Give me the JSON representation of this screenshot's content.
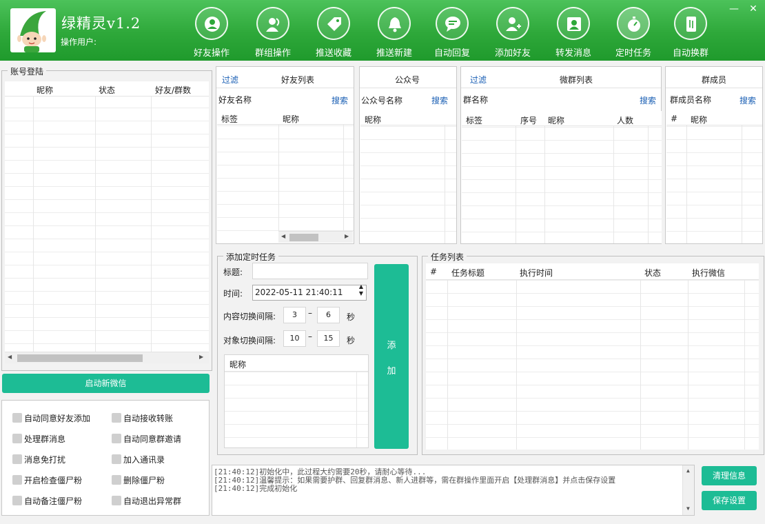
{
  "app": {
    "title": "绿精灵v1.2",
    "operator_label": "操作用户:"
  },
  "nav": [
    {
      "label": "好友操作",
      "icon": "user-circle-icon"
    },
    {
      "label": "群组操作",
      "icon": "group-icon"
    },
    {
      "label": "推送收藏",
      "icon": "tag-icon"
    },
    {
      "label": "推送新建",
      "icon": "bell-icon"
    },
    {
      "label": "自动回复",
      "icon": "chat-bubble-icon"
    },
    {
      "label": "添加好友",
      "icon": "add-user-icon"
    },
    {
      "label": "转发消息",
      "icon": "contact-card-icon"
    },
    {
      "label": "定时任务",
      "icon": "stopwatch-icon"
    },
    {
      "label": "自动换群",
      "icon": "phone-swap-icon"
    }
  ],
  "window_controls": {
    "minimize": "—",
    "close": "✕"
  },
  "account": {
    "legend": "账号登陆",
    "columns": [
      "昵称",
      "状态",
      "好友/群数"
    ],
    "start_button": "启动新微信"
  },
  "options": [
    "自动同意好友添加",
    "自动接收转账",
    "处理群消息",
    "自动同意群邀请",
    "消息免打扰",
    "加入通讯录",
    "开启检查僵尸粉",
    "删除僵尸粉",
    "自动备注僵尸粉",
    "自动退出异常群"
  ],
  "friends": {
    "filter": "过滤",
    "title": "好友列表",
    "search_label": "好友名称",
    "search_btn": "搜索",
    "columns": [
      "标签",
      "昵称"
    ]
  },
  "official": {
    "title": "公众号",
    "search_label": "公众号名称",
    "search_btn": "搜索",
    "columns": [
      "昵称"
    ]
  },
  "groups": {
    "filter": "过滤",
    "title": "微群列表",
    "search_label": "群名称",
    "search_btn": "搜索",
    "columns": [
      "标签",
      "序号",
      "昵称",
      "人数"
    ]
  },
  "members": {
    "title": "群成员",
    "search_label": "群成员名称",
    "search_btn": "搜索",
    "columns": [
      "#",
      "昵称"
    ]
  },
  "add_task": {
    "legend": "添加定时任务",
    "title_label": "标题:",
    "title_value": "",
    "time_label": "时间:",
    "time_value": "2022-05-11 21:40:11",
    "content_interval_label": "内容切换间隔:",
    "content_min": "3",
    "content_max": "6",
    "object_interval_label": "对象切换间隔:",
    "object_min": "10",
    "object_max": "15",
    "dash": "–",
    "unit": "秒",
    "list_column": "昵称",
    "add_btn_1": "添",
    "add_btn_2": "加"
  },
  "task_list": {
    "legend": "任务列表",
    "columns": [
      "#",
      "任务标题",
      "执行时间",
      "状态",
      "执行微信"
    ]
  },
  "log": [
    "[21:40:12]初始化中，此过程大约需要20秒，请耐心等待...",
    "[21:40:12]温馨提示：如果需要护群、回复群消息、新人进群等，需在群操作里面开启【处理群消息】并点击保存设置",
    "[21:40:12]完成初始化"
  ],
  "buttons": {
    "clear": "清理信息",
    "save": "保存设置"
  },
  "colors": {
    "header": "#2ea83a",
    "accent": "#1dbc95",
    "link": "#1a5fb4"
  }
}
